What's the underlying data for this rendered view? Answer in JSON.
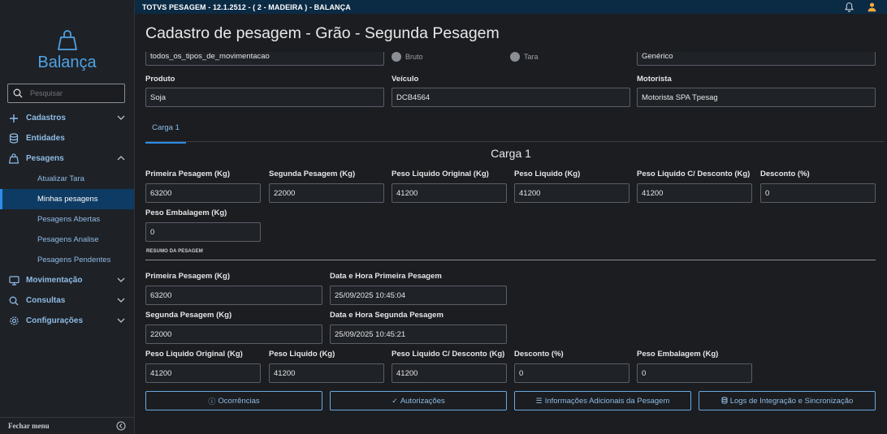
{
  "topbar": {
    "title": "TOTVS PESAGEM - 12.1.2512 - ( 2 - MADEIRA ) - BALANÇA"
  },
  "brand": {
    "name": "Balança"
  },
  "search": {
    "placeholder": "Pesquisar"
  },
  "sidebar": {
    "cadastros": "Cadastros",
    "entidades": "Entidades",
    "pesagens": "Pesagens",
    "atualizar_tara": "Atualizar Tara",
    "minhas_pesagens": "Minhas pesagens",
    "pesagens_abertas": "Pesagens Abertas",
    "pesagens_analise": "Pesagens Analise",
    "pesagens_pendentes": "Pesagens Pendentes",
    "movimentacao": "Movimentação",
    "consultas": "Consultas",
    "configuracoes": "Configurações",
    "fechar_menu": "Fechar menu"
  },
  "page": {
    "title": "Cadastro de pesagem - Grão - Segunda Pesagem"
  },
  "top_partial": {
    "tipo_movimentacao": "todos_os_tipos_de_movimentacao",
    "radio_bruto": "Bruto",
    "radio_tara": "Tara",
    "generico": "Genérico"
  },
  "form": {
    "produto_label": "Produto",
    "produto_value": "Soja",
    "veiculo_label": "Veículo",
    "veiculo_value": "DCB4564",
    "motorista_label": "Motorista",
    "motorista_value": "Motorista SPA Tpesag"
  },
  "tabs": {
    "carga1": "Carga 1"
  },
  "carga": {
    "title": "Carga 1",
    "primeira_label": "Primeira Pesagem (Kg)",
    "primeira_value": "63200",
    "segunda_label": "Segunda Pesagem (Kg)",
    "segunda_value": "22000",
    "liq_orig_label": "Peso Liquido Original (Kg)",
    "liq_orig_value": "41200",
    "liq_label": "Peso Liquido (Kg)",
    "liq_value": "41200",
    "liq_desc_label": "Peso Liquido C/ Desconto (Kg)",
    "liq_desc_value": "41200",
    "desconto_label": "Desconto (%)",
    "desconto_value": "0",
    "embalagem_label": "Peso Embalagem (Kg)",
    "embalagem_value": "0"
  },
  "resumo": {
    "title": "RESUMO DA PESAGEM",
    "primeira_label": "Primeira Pesagem (Kg)",
    "primeira_value": "63200",
    "data_primeira_label": "Data e Hora Primeira Pesagem",
    "data_primeira_value": "25/09/2025 10:45:04",
    "segunda_label": "Segunda Pesagem (Kg)",
    "segunda_value": "22000",
    "data_segunda_label": "Data e Hora Segunda Pesagem",
    "data_segunda_value": "25/09/2025 10:45:21",
    "liq_orig_label": "Peso Liquido Original (Kg)",
    "liq_orig_value": "41200",
    "liq_label": "Peso Liquido (Kg)",
    "liq_value": "41200",
    "liq_desc_label": "Peso Liquido C/ Desconto (Kg)",
    "liq_desc_value": "41200",
    "desconto_label": "Desconto (%)",
    "desconto_value": "0",
    "embalagem_label": "Peso Embalagem (Kg)",
    "embalagem_value": "0"
  },
  "buttons": {
    "ocorrencias": "Ocorrências",
    "autorizacoes": "Autorizações",
    "informacoes": "Informações Adicionais da Pesagem",
    "logs": "Logs de Integração e Sincronização"
  }
}
